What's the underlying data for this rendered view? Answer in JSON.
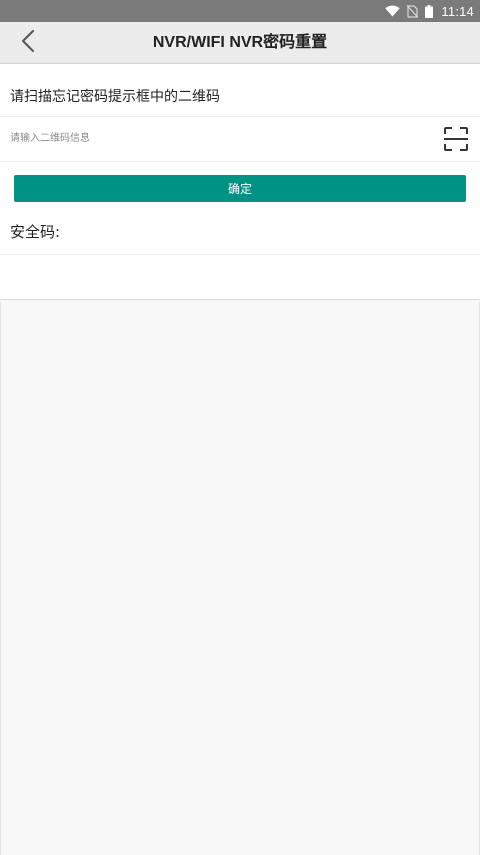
{
  "status_bar": {
    "time": "11:14",
    "icons": [
      "wifi-icon",
      "no-sim-icon",
      "battery-icon"
    ]
  },
  "header": {
    "title": "NVR/WIFI NVR密码重置",
    "back_icon": "chevron-left-icon"
  },
  "form": {
    "scan_prompt": "请扫描忘记密码提示框中的二维码",
    "qr_input": {
      "placeholder": "请输入二维码信息",
      "value": ""
    },
    "scan_icon": "scan-frame-icon",
    "confirm_label": "确定",
    "security_code_label": "安全码:",
    "security_code_value": ""
  },
  "colors": {
    "accent": "#009383",
    "status_bar": "#7a7a7a",
    "title_bar": "#ececec",
    "background": "#f8f8f8"
  }
}
